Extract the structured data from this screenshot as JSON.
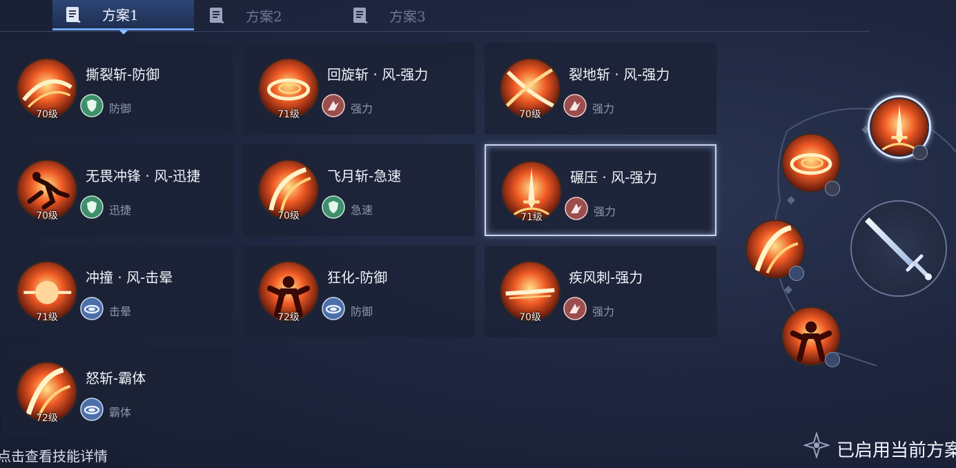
{
  "tabs": [
    {
      "label": "方案1",
      "active": true
    },
    {
      "label": "方案2",
      "active": false
    },
    {
      "label": "方案3",
      "active": false
    }
  ],
  "skills": [
    {
      "name": "撕裂斩-防御",
      "level": "70级",
      "type": "防御",
      "type_icon": "shield-icon",
      "art": "slash-swirl",
      "selected": false
    },
    {
      "name": "回旋斩 · 风-强力",
      "level": "71级",
      "type": "强力",
      "type_icon": "power-icon",
      "art": "whirl",
      "selected": false
    },
    {
      "name": "裂地斩 · 风-强力",
      "level": "70级",
      "type": "强力",
      "type_icon": "power-icon",
      "art": "cross-slash",
      "selected": false
    },
    {
      "name": "无畏冲锋 · 风-迅捷",
      "level": "70级",
      "type": "迅捷",
      "type_icon": "shield-icon",
      "art": "charge-runner",
      "selected": false
    },
    {
      "name": "飞月斩-急速",
      "level": "70级",
      "type": "急速",
      "type_icon": "shield-icon",
      "art": "moon-slash",
      "selected": false
    },
    {
      "name": "碾压 · 风-强力",
      "level": "71级",
      "type": "强力",
      "type_icon": "power-icon",
      "art": "sword-crush",
      "selected": true
    },
    {
      "name": "冲撞 · 风-击晕",
      "level": "71级",
      "type": "击晕",
      "type_icon": "stun-icon",
      "art": "fist",
      "selected": false
    },
    {
      "name": "狂化-防御",
      "level": "72级",
      "type": "防御",
      "type_icon": "stun-icon",
      "art": "berserk",
      "selected": false
    },
    {
      "name": "疾风刺-强力",
      "level": "70级",
      "type": "强力",
      "type_icon": "power-icon",
      "art": "thrust",
      "selected": false
    },
    {
      "name": "怒斩-霸体",
      "level": "72级",
      "type": "霸体",
      "type_icon": "stun-icon",
      "art": "rage-slash",
      "selected": false
    }
  ],
  "wheel": {
    "center_icon": "sword-icon",
    "slots": [
      {
        "art": "sword-crush",
        "badge": "power-icon"
      },
      {
        "art": "whirl",
        "badge": "power-icon"
      },
      {
        "art": "rage-slash",
        "badge": "stun-icon"
      },
      {
        "art": "berserk",
        "badge": "stun-icon"
      }
    ]
  },
  "footer": {
    "hint": "点击查看技能详情",
    "status": "已启用当前方案"
  },
  "colors": {
    "accent": "#6fa8ff",
    "fire": "#e0452a",
    "badge_shield": "#3e8f6a",
    "badge_power": "#9c4e4e",
    "badge_stun": "#4b6fa8"
  }
}
